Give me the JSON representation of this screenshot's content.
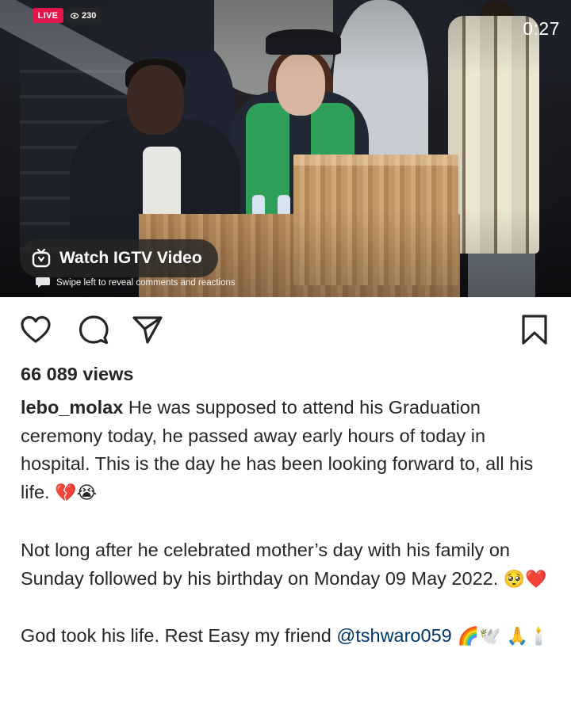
{
  "video": {
    "live_label": "LIVE",
    "viewer_count": "230",
    "timestamp": "0:27",
    "igtv_label": "Watch IGTV Video",
    "swipe_hint": "Swipe left to reveal comments and reactions"
  },
  "actions": {
    "like_icon": "heart-icon",
    "comment_icon": "comment-icon",
    "share_icon": "share-icon",
    "save_icon": "bookmark-icon"
  },
  "post": {
    "views": "66 089 views",
    "username": "lebo_molax",
    "caption_1": " He was supposed to attend his Graduation ceremony today, he passed away early hours of today in hospital. This is the day he has been looking forward to, all his life. ",
    "caption_1_emoji": "💔😭",
    "caption_2": "Not long after he celebrated mother’s day with his family on Sunday followed by his birthday on Monday 09 May 2022. ",
    "caption_2_emoji": "🥺❤️",
    "caption_3": "God took his life. Rest Easy my friend ",
    "mention": "@tshwaro059",
    "caption_3_emoji": " 🌈🕊️ 🙏🕯️"
  },
  "colors": {
    "live_red": "#e4154a",
    "mention_blue": "#00376b",
    "text": "#262626"
  }
}
